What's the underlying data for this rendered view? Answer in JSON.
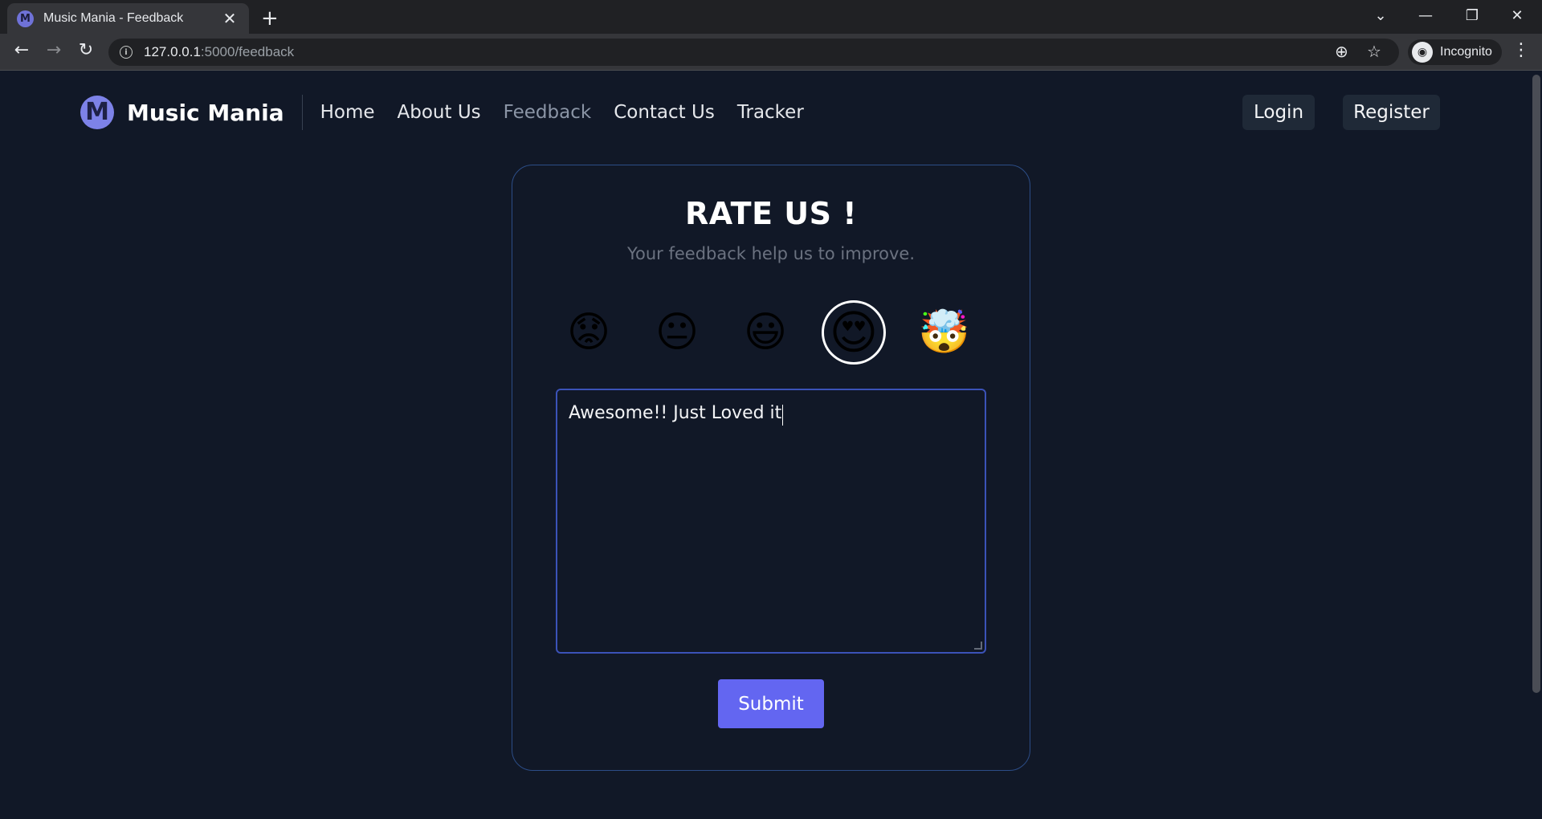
{
  "browser": {
    "tab_title": "Music Mania - Feedback",
    "tab_favicon": "M",
    "close_glyph": "✕",
    "new_tab_glyph": "+",
    "url_host": "127.0.0.1",
    "url_path": ":5000/feedback",
    "incognito_label": "Incognito",
    "icons": {
      "back": "←",
      "forward": "→",
      "reload": "↻",
      "info": "i",
      "zoom": "⊕",
      "star": "☆",
      "menu": "⋮",
      "tab_search": "⌄",
      "minimize": "—",
      "restore": "❐",
      "close": "✕",
      "incognito": "◉"
    }
  },
  "nav": {
    "brand": "Music Mania",
    "logo_letter": "M",
    "links": [
      "Home",
      "About Us",
      "Feedback",
      "Contact Us",
      "Tracker"
    ],
    "active_link": "Feedback",
    "login": "Login",
    "register": "Register"
  },
  "feedback": {
    "title": "RATE US !",
    "subtitle": "Your feedback help us to improve.",
    "emojis": [
      {
        "name": "worried-face",
        "glyph": "😟"
      },
      {
        "name": "neutral-face",
        "glyph": "😐"
      },
      {
        "name": "grinning-face",
        "glyph": "😃"
      },
      {
        "name": "heart-eyes-face",
        "glyph": "😍"
      },
      {
        "name": "exploding-head",
        "glyph": "🤯"
      }
    ],
    "selected_rating": 4,
    "text_value": "Awesome!! Just Loved it",
    "submit_label": "Submit"
  },
  "colors": {
    "page_bg": "#111827",
    "accent": "#6366f1",
    "card_border": "#2c4d87",
    "textarea_border": "#3b52b8",
    "logo_purple": "#7d82e8"
  }
}
